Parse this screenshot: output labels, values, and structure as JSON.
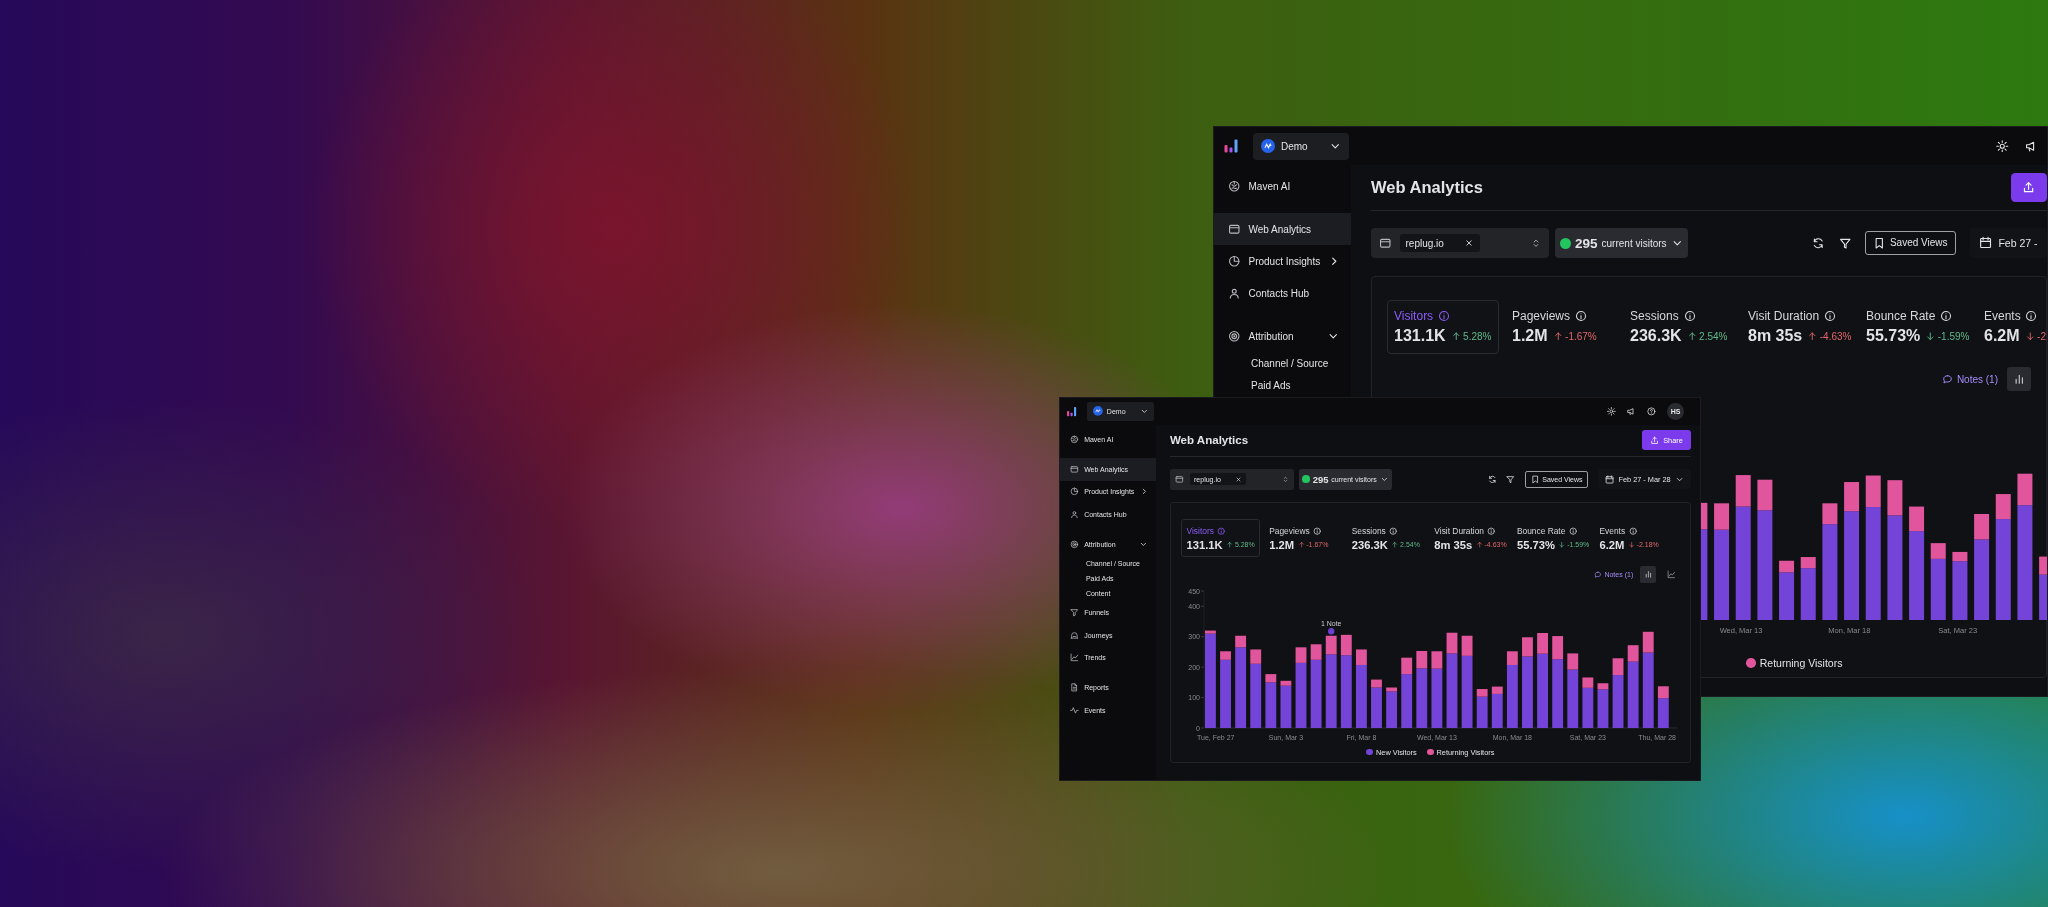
{
  "windows": [
    {
      "workspace": "Demo",
      "sidebar": [
        {
          "items": [
            {
              "label": "Maven AI",
              "selected": false
            }
          ]
        },
        {
          "items": [
            {
              "label": "Web Analytics",
              "selected": true
            },
            {
              "label": "Product Insights",
              "selected": false,
              "expanded": false
            },
            {
              "label": "Contacts Hub",
              "selected": false
            }
          ]
        },
        {
          "items": [
            {
              "label": "Attribution",
              "selected": false,
              "expanded": true,
              "children": [
                {
                  "label": "Channel / Source",
                  "selected": false
                },
                {
                  "label": "Paid Ads",
                  "selected": false
                }
              ]
            }
          ]
        }
      ],
      "title": "Web Analytics",
      "domain": "replug.io",
      "live_count": "295",
      "live_label": "current visitors",
      "saved_views": "Saved Views",
      "date_range": "Feb 27 -",
      "date_caret": false,
      "metrics": [
        {
          "label": "Visitors",
          "value": "131.1K",
          "rising": true,
          "good": true,
          "change": "5.28%",
          "selected": true
        },
        {
          "label": "Pageviews",
          "value": "1.2M",
          "rising": true,
          "good": false,
          "change": "-1.67%",
          "selected": false
        },
        {
          "label": "Sessions",
          "value": "236.3K",
          "rising": true,
          "good": true,
          "change": "2.54%",
          "selected": false
        },
        {
          "label": "Visit Duration",
          "value": "8m 35s",
          "rising": true,
          "good": false,
          "change": "-4.63%",
          "selected": false
        },
        {
          "label": "Bounce Rate",
          "value": "55.73%",
          "rising": false,
          "good": true,
          "change": "-1.59%",
          "selected": false
        },
        {
          "label": "Events",
          "value": "6.2M",
          "rising": false,
          "good": false,
          "change": "-2",
          "selected": false
        }
      ],
      "notes": "Notes (1)",
      "chart_toggles": [
        {
          "selected": true
        }
      ],
      "chart": {
        "x_labels": [
          "Wed, Mar 13",
          "Mon, Mar 18",
          "Sat, Mar 23"
        ],
        "legend": [
          {
            "label": "Returning Visitors",
            "color": "#e0559b"
          }
        ]
      }
    },
    {
      "workspace": "Demo",
      "avatar": "HS",
      "sidebar": [
        {
          "items": [
            {
              "label": "Maven AI",
              "selected": false
            }
          ]
        },
        {
          "items": [
            {
              "label": "Web Analytics",
              "selected": true
            },
            {
              "label": "Product Insights",
              "selected": false,
              "expanded": false
            },
            {
              "label": "Contacts Hub",
              "selected": false
            }
          ]
        },
        {
          "items": [
            {
              "label": "Attribution",
              "selected": false,
              "expanded": true,
              "children": [
                {
                  "label": "Channel / Source",
                  "selected": false
                },
                {
                  "label": "Paid Ads",
                  "selected": false
                },
                {
                  "label": "Content",
                  "selected": false
                }
              ]
            },
            {
              "label": "Funnels",
              "selected": false
            },
            {
              "label": "Journeys",
              "selected": false
            },
            {
              "label": "Trends",
              "selected": false
            }
          ]
        },
        {
          "items": [
            {
              "label": "Reports",
              "selected": false
            },
            {
              "label": "Events",
              "selected": false
            }
          ]
        }
      ],
      "title": "Web Analytics",
      "share_label": "Share",
      "domain": "replug.io",
      "live_count": "295",
      "live_label": "current visitors",
      "saved_views": "Saved Views",
      "date_range": "Feb 27 - Mar 28",
      "date_caret": true,
      "metrics": [
        {
          "label": "Visitors",
          "value": "131.1K",
          "rising": true,
          "good": true,
          "change": "5.28%",
          "selected": true
        },
        {
          "label": "Pageviews",
          "value": "1.2M",
          "rising": true,
          "good": false,
          "change": "-1.67%",
          "selected": false
        },
        {
          "label": "Sessions",
          "value": "236.3K",
          "rising": true,
          "good": true,
          "change": "2.54%",
          "selected": false
        },
        {
          "label": "Visit Duration",
          "value": "8m 35s",
          "rising": true,
          "good": false,
          "change": "-4.63%",
          "selected": false
        },
        {
          "label": "Bounce Rate",
          "value": "55.73%",
          "rising": false,
          "good": true,
          "change": "-1.59%",
          "selected": false
        },
        {
          "label": "Events",
          "value": "6.2M",
          "rising": false,
          "good": false,
          "change": "-2.18%",
          "selected": false
        }
      ],
      "notes": "Notes (1)",
      "chart_toggles": [
        {
          "selected": true
        },
        {
          "selected": false
        }
      ],
      "chart": {
        "chart_data": {
          "type": "bar",
          "stacked": true,
          "categories": [
            "Tue, Feb 27",
            null,
            null,
            null,
            null,
            "Sun, Mar 3",
            null,
            null,
            null,
            null,
            "Fri, Mar 8",
            null,
            null,
            null,
            null,
            "Wed, Mar 13",
            null,
            null,
            null,
            null,
            "Mon, Mar 18",
            null,
            null,
            null,
            null,
            "Sat, Mar 23",
            null,
            null,
            null,
            null,
            "Thu, Mar 28"
          ],
          "ylim": [
            0,
            450
          ],
          "yticks": [
            0,
            100,
            200,
            300,
            400,
            450
          ],
          "series": [
            {
              "name": "New Visitors",
              "color": "#7444d8",
              "values": [
                310,
                224,
                265,
                211,
                150,
                139,
                214,
                224,
                242,
                239,
                207,
                133,
                120,
                177,
                196,
                195,
                245,
                237,
                103,
                112,
                207,
                235,
                244,
                226,
                192,
                132,
                127,
                174,
                218,
                248,
                98
              ]
            },
            {
              "name": "Returning Visitors",
              "color": "#e0559b",
              "values": [
                10,
                28,
                38,
                47,
                27,
                16,
                51,
                51,
                61,
                67,
                51,
                26,
                13,
                54,
                57,
                57,
                68,
                66,
                25,
                24,
                45,
                63,
                68,
                76,
                53,
                34,
                20,
                55,
                54,
                68,
                39
              ]
            }
          ],
          "annotations": [
            "1 Note"
          ],
          "legend": "bottom"
        }
      }
    }
  ]
}
